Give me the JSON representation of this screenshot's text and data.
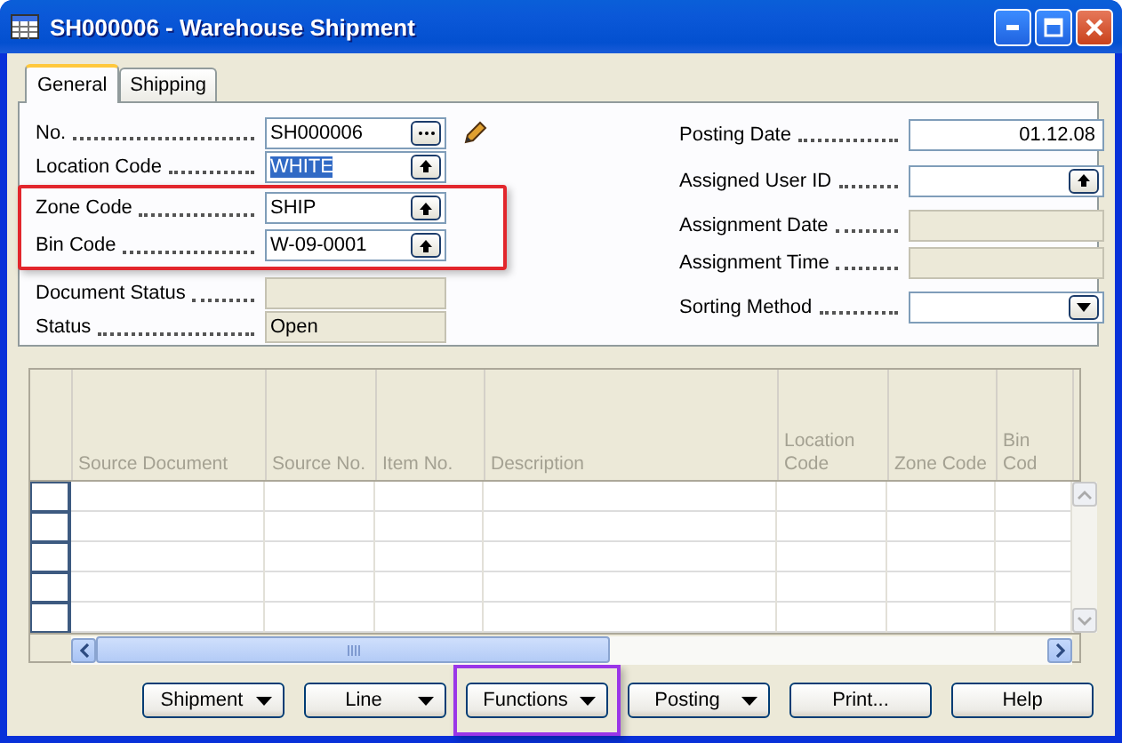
{
  "window": {
    "title": "SH000006 - Warehouse Shipment"
  },
  "tabs": [
    {
      "label": "General",
      "selected": true
    },
    {
      "label": "Shipping",
      "selected": false
    }
  ],
  "left_fields": [
    {
      "label": "No.",
      "value": "SH000006",
      "kind": "assist",
      "text_selected": false,
      "framed": false
    },
    {
      "label": "Location Code",
      "value": "WHITE",
      "kind": "lookup",
      "text_selected": true,
      "framed": false
    },
    {
      "label": "Zone Code",
      "value": "SHIP",
      "kind": "lookup",
      "text_selected": false,
      "framed": true
    },
    {
      "label": "Bin Code",
      "value": "W-09-0001",
      "kind": "lookup",
      "text_selected": false,
      "framed": true
    },
    {
      "label": "Document Status",
      "kind": "readonly",
      "text_selected": false,
      "framed": false
    },
    {
      "label": "Status",
      "value": "Open",
      "kind": "readonly",
      "text_selected": false,
      "framed": false
    }
  ],
  "right_fields": [
    {
      "label": "Posting Date",
      "value": "01.12.08",
      "kind": "date",
      "text_selected": false,
      "framed": false
    },
    {
      "label": "Assigned User ID",
      "kind": "lookup",
      "text_selected": false,
      "framed": false
    },
    {
      "label": "Assignment Date",
      "kind": "readonly",
      "text_selected": false,
      "framed": false
    },
    {
      "label": "Assignment Time",
      "kind": "readonly",
      "text_selected": false,
      "framed": false
    },
    {
      "label": "Sorting Method",
      "kind": "dropdown",
      "text_selected": false,
      "framed": false
    }
  ],
  "table": {
    "columns": [
      "Source Document",
      "Source No.",
      "Item No.",
      "Description",
      "Location Code",
      "Zone Code",
      "Bin Cod"
    ]
  },
  "buttons": [
    {
      "label": "Shipment",
      "kind": "menu",
      "framed": false
    },
    {
      "label": "Line",
      "kind": "menu",
      "framed": false
    },
    {
      "label": "Functions",
      "kind": "menu",
      "framed": true
    },
    {
      "label": "Posting",
      "kind": "menu",
      "framed": false
    },
    {
      "label": "Print...",
      "kind": "plain",
      "framed": false
    },
    {
      "label": "Help",
      "kind": "plain",
      "framed": false
    }
  ]
}
